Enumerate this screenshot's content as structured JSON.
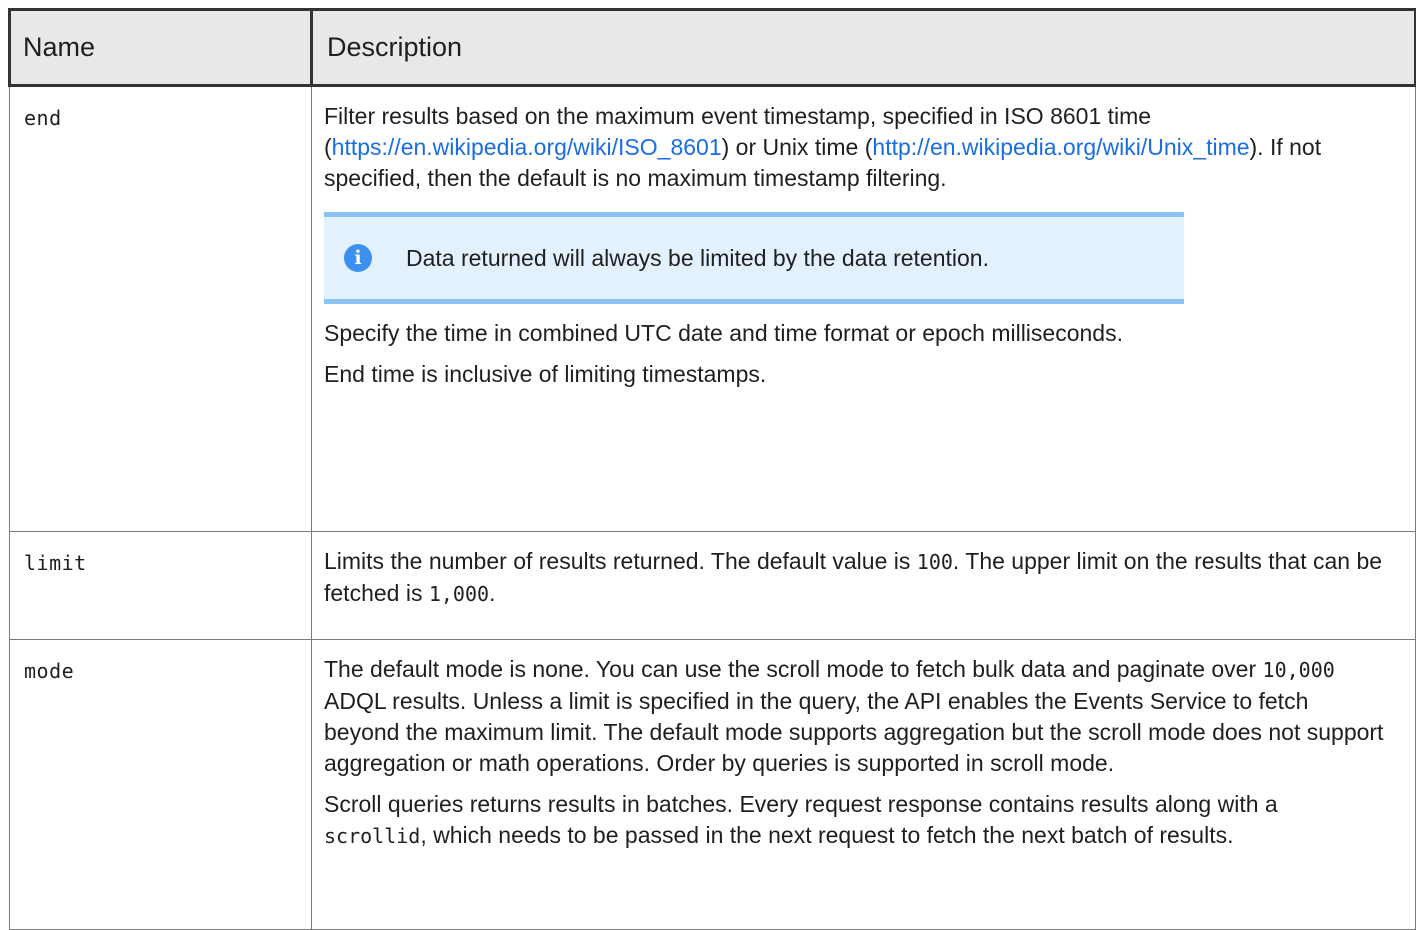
{
  "table": {
    "headers": {
      "name": "Name",
      "description": "Description"
    },
    "rows": [
      {
        "name": "end",
        "p1_text1": "Filter results based on the maximum event timestamp, specified in ISO 8601 time (",
        "p1_link1": "https://en.wikipedia.org/wiki/ISO_8601",
        "p1_text2": ") or Unix time (",
        "p1_link2": "http://en.wikipedia.org/wiki/Unix_time",
        "p1_text3": "). If not specified, then the default is no maximum timestamp filtering.",
        "note": {
          "icon": "info-icon",
          "text": "Data returned will always be limited by the data retention."
        },
        "p2": "Specify the time in combined UTC date and time format or epoch milliseconds.",
        "p3": "End time is inclusive of limiting timestamps."
      },
      {
        "name": "limit",
        "text1": "Limits the number of results returned. The default value is ",
        "code1": "100",
        "text2": ". The upper limit on the results that can be fetched is ",
        "code2": "1,000",
        "text3": "."
      },
      {
        "name": "mode",
        "p1_text1": "The default mode is none. You can use the scroll mode to fetch bulk data and paginate over ",
        "p1_code1": "10,000",
        "p1_text2": " ADQL results. Unless a limit is specified in the query, the API enables the Events Service to fetch beyond the maximum limit. The default mode supports aggregation but the scroll mode does not support aggregation or math operations. Order by queries is supported in scroll mode.",
        "p2_text1": "Scroll queries returns results in batches. Every request response contains results along with a ",
        "p2_code1": "scrollid",
        "p2_text2": ", which needs to be passed in the next request to fetch the next batch of results."
      }
    ]
  },
  "colors": {
    "link": "#1a6ee0",
    "info_background": "#e3f1ff",
    "info_border": "#8cc3f5",
    "info_icon": "#3d8ff0",
    "header_background": "#e8e8e8"
  }
}
